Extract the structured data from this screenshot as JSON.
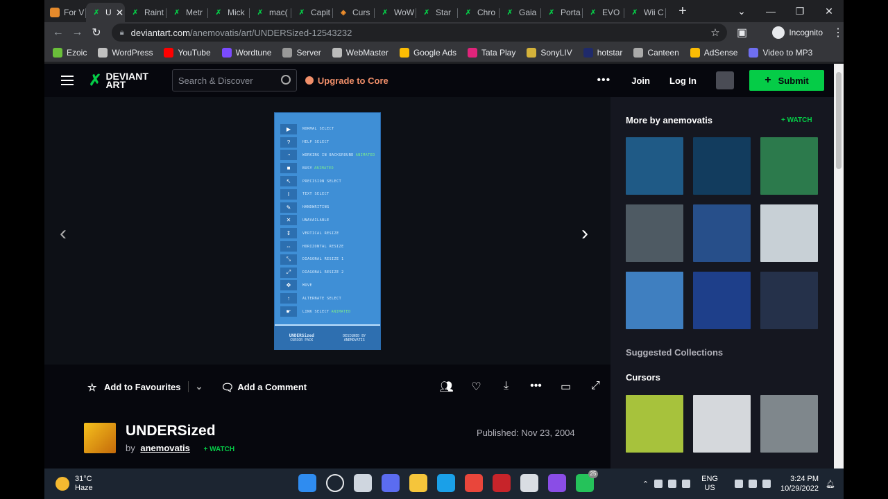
{
  "browser": {
    "tabs": [
      {
        "label": "For V",
        "fav": "fav-orange"
      },
      {
        "label": "U",
        "fav": "da",
        "active": true
      },
      {
        "label": "Raint",
        "fav": "da"
      },
      {
        "label": "Metr",
        "fav": "da"
      },
      {
        "label": "Mick",
        "fav": "da"
      },
      {
        "label": "mac(",
        "fav": "da"
      },
      {
        "label": "Capit",
        "fav": "da"
      },
      {
        "label": "Curs",
        "fav": "orange-diamond"
      },
      {
        "label": "WoW",
        "fav": "da"
      },
      {
        "label": "Star",
        "fav": "da"
      },
      {
        "label": "Chro",
        "fav": "da"
      },
      {
        "label": "Gaia",
        "fav": "da"
      },
      {
        "label": "Porta",
        "fav": "da"
      },
      {
        "label": "EVO",
        "fav": "da"
      },
      {
        "label": "Wii C",
        "fav": "da"
      }
    ],
    "url_host": "deviantart.com",
    "url_path": "/anemovatis/art/UNDERSized-12543232",
    "profile_label": "Incognito",
    "bookmarks": [
      {
        "label": "Ezoic",
        "color": "#6abf3a"
      },
      {
        "label": "WordPress",
        "color": "#c0c0c0"
      },
      {
        "label": "YouTube",
        "color": "#ff0000"
      },
      {
        "label": "Wordtune",
        "color": "#7b4bff"
      },
      {
        "label": "Server",
        "color": "#999999"
      },
      {
        "label": "WebMaster",
        "color": "#bbbbbb"
      },
      {
        "label": "Google Ads",
        "color": "#fbbc04"
      },
      {
        "label": "Tata Play",
        "color": "#e0247b"
      },
      {
        "label": "SonyLIV",
        "color": "#d4b23a"
      },
      {
        "label": "hotstar",
        "color": "#1f2a6b"
      },
      {
        "label": "Canteen",
        "color": "#aaaaaa"
      },
      {
        "label": "AdSense",
        "color": "#fbbc04"
      },
      {
        "label": "Video to MP3",
        "color": "#6f6ff0"
      }
    ]
  },
  "header": {
    "logo_line1": "DEVIANT",
    "logo_line2": "ART",
    "search_placeholder": "Search & Discover",
    "upgrade_label": "Upgrade to Core",
    "join_label": "Join",
    "login_label": "Log In",
    "submit_label": "Submit"
  },
  "artwork": {
    "rows": [
      {
        "label": "NORMAL SELECT",
        "anim": ""
      },
      {
        "label": "HELP SELECT",
        "anim": ""
      },
      {
        "label": "WORKING IN BACKGROUND",
        "anim": "ANIMATED"
      },
      {
        "label": "BUSY",
        "anim": "ANIMATED"
      },
      {
        "label": "PRECISION SELECT",
        "anim": ""
      },
      {
        "label": "TEXT SELECT",
        "anim": ""
      },
      {
        "label": "HANDWRITING",
        "anim": ""
      },
      {
        "label": "UNAVAILABLE",
        "anim": ""
      },
      {
        "label": "VERTICAL RESIZE",
        "anim": ""
      },
      {
        "label": "HORIZONTAL RESIZE",
        "anim": ""
      },
      {
        "label": "DIAGONAL RESIZE 1",
        "anim": ""
      },
      {
        "label": "DIAGONAL RESIZE 2",
        "anim": ""
      },
      {
        "label": "MOVE",
        "anim": ""
      },
      {
        "label": "ALTERNATE SELECT",
        "anim": ""
      },
      {
        "label": "LINK SELECT",
        "anim": "ANIMATED"
      }
    ],
    "footer_title": "UNDERSized",
    "footer_sub": "CURSOR PACK",
    "footer_right1": "DESIGNED BY",
    "footer_right2": "ANEMOVATIS"
  },
  "deviation": {
    "add_fav_label": "Add to Favourites",
    "comment_label": "Add a Comment",
    "title": "UNDERSized",
    "by_label": "by",
    "author": "anemovatis",
    "watch_label": "+ WATCH",
    "published": "Published: Nov 23, 2004"
  },
  "sidebar": {
    "more_by_label": "More by anemovatis",
    "watch_label": "+ WATCH",
    "thumb_colors": [
      "#1f5a86",
      "#123c5e",
      "#2c7a4c",
      "#4e5a63",
      "#274f8a",
      "#c8d0d6",
      "#3f7fc0",
      "#1e3f8a",
      "#25314a"
    ],
    "suggested_label": "Suggested Collections",
    "collection_label": "Cursors",
    "collection_thumb_colors": [
      "#a7c23c",
      "#d5d8dc",
      "#7f878c"
    ]
  },
  "taskbar": {
    "temp": "31°C",
    "weather": "Haze",
    "app_colors": [
      "#2f8cf0",
      "#1c2531",
      "#cfd6df",
      "#5b6cf0",
      "#f5c53b",
      "#1aa0e8",
      "#e9463b",
      "#c7242a",
      "#d9dde3",
      "#8a4de6",
      "#25c25a"
    ],
    "lang1": "ENG",
    "lang2": "US",
    "time": "3:24 PM",
    "date": "10/29/2022",
    "whatsapp_badge": "25"
  }
}
